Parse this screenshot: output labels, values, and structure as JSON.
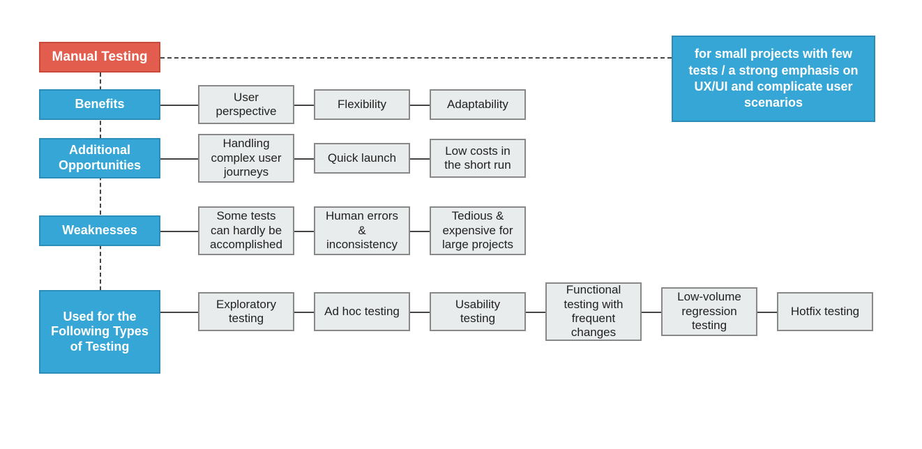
{
  "title": "Manual Testing",
  "summary": "for small projects with few tests / a strong emphasis on UX/UI and complicate user scenarios",
  "rows": {
    "benefits": {
      "label": "Benefits",
      "items": [
        "User perspective",
        "Flexibility",
        "Adaptability"
      ]
    },
    "additional_opportunities": {
      "label": "Additional Opportunities",
      "items": [
        "Handling complex user journeys",
        "Quick launch",
        "Low costs in the short run"
      ]
    },
    "weaknesses": {
      "label": "Weaknesses",
      "items": [
        "Some tests can hardly be accomplished",
        "Human errors & inconsistency",
        "Tedious & expensive for large projects"
      ]
    },
    "used_for": {
      "label": "Used for the Following Types of Testing",
      "items": [
        "Exploratory testing",
        "Ad hoc testing",
        "Usability testing",
        "Functional testing with frequent changes",
        "Low-volume regression testing",
        "Hotfix testing"
      ]
    }
  }
}
